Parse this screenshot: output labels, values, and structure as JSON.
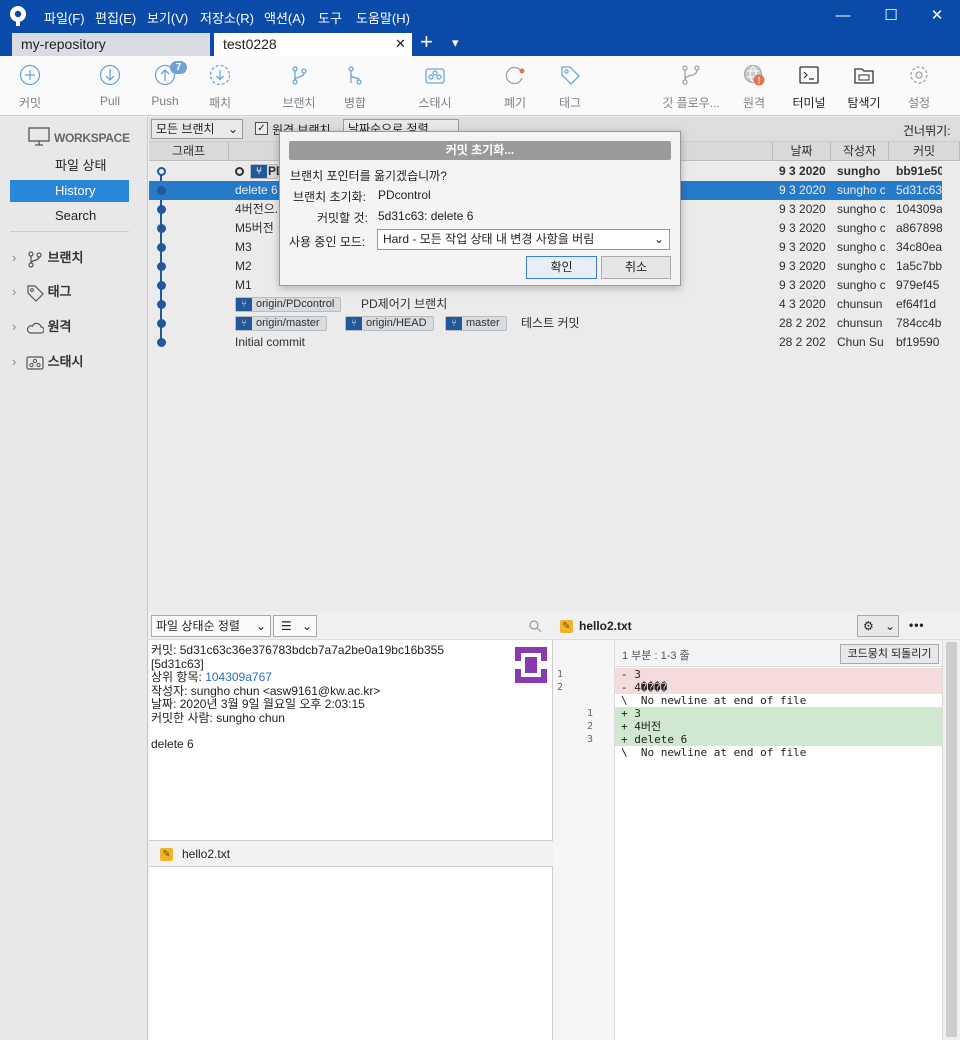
{
  "menubar": {
    "items": [
      "파일(F)",
      "편집(E)",
      "보기(V)",
      "저장소(R)",
      "액션(A)",
      "도구",
      "도움말(H)"
    ]
  },
  "window_controls": {
    "minimize": "—",
    "maximize": "☐",
    "close": "✕"
  },
  "tabs": [
    {
      "label": "my-repository",
      "active": false
    },
    {
      "label": "test0228",
      "active": true
    }
  ],
  "tabbar": {
    "close_glyph": "✕",
    "add_glyph": "+",
    "dropdown_glyph": "▾"
  },
  "toolbar": {
    "buttons": [
      {
        "label": "커밋",
        "icon": "plus-circle-icon"
      },
      {
        "label": "Pull",
        "icon": "arrow-down-circle-icon"
      },
      {
        "label": "Push",
        "icon": "arrow-up-circle-icon",
        "badge": "7"
      },
      {
        "label": "패치",
        "icon": "patch-icon"
      },
      {
        "label": "브랜치",
        "icon": "branch-icon"
      },
      {
        "label": "병합",
        "icon": "merge-icon"
      },
      {
        "label": "스태시",
        "icon": "stash-icon"
      },
      {
        "label": "폐기",
        "icon": "discard-icon"
      },
      {
        "label": "태그",
        "icon": "tag-icon"
      },
      {
        "label": "깃 플로우...",
        "icon": "git-flow-icon"
      },
      {
        "label": "원격",
        "icon": "globe-icon"
      },
      {
        "label": "터미널",
        "icon": "terminal-icon"
      },
      {
        "label": "탐색기",
        "icon": "folder-icon"
      },
      {
        "label": "설정",
        "icon": "gear-icon"
      }
    ]
  },
  "sidebar": {
    "workspace_label": "WORKSPACE",
    "items": [
      "파일 상태",
      "History",
      "Search"
    ],
    "selected": "History",
    "groups": [
      "브랜치",
      "태그",
      "원격",
      "스태시"
    ]
  },
  "history": {
    "filter": {
      "branch_select": "모든 브랜치",
      "checkbox_label": "원격 브랜치",
      "sort_select": "날짜순으로 정렬",
      "skip_label": "건너뛰기:"
    },
    "columns": {
      "graph": "그래프",
      "date": "날짜",
      "author": "작성자",
      "commit": "커밋"
    },
    "rows": [
      {
        "message": "PD",
        "date": "9 3 2020",
        "author": "sungho",
        "commit": "bb91e50",
        "bold": true,
        "badges": []
      },
      {
        "message": "delete 6",
        "date": "9 3 2020",
        "author": "sungho c",
        "commit": "5d31c63",
        "selected": true,
        "badges": []
      },
      {
        "message": "4버전으...",
        "date": "9 3 2020",
        "author": "sungho c",
        "commit": "104309a",
        "badges": []
      },
      {
        "message": "M5버전",
        "date": "9 3 2020",
        "author": "sungho c",
        "commit": "a867898",
        "badges": []
      },
      {
        "message": "M3",
        "date": "9 3 2020",
        "author": "sungho c",
        "commit": "34c80ea",
        "badges": []
      },
      {
        "message": "M2",
        "date": "9 3 2020",
        "author": "sungho c",
        "commit": "1a5c7bb",
        "badges": []
      },
      {
        "message": "M1",
        "date": "9 3 2020",
        "author": "sungho c",
        "commit": "979ef45",
        "badges": []
      },
      {
        "message": "PD제어기 브랜치",
        "date": "4 3 2020",
        "author": "chunsun",
        "commit": "ef64f1d",
        "badges": [
          "origin/PDcontrol"
        ]
      },
      {
        "message": "테스트 커밋",
        "date": "28 2 202",
        "author": "chunsun",
        "commit": "784cc4b",
        "badges": [
          "origin/master",
          "origin/HEAD",
          "master"
        ]
      },
      {
        "message": "Initial commit",
        "date": "28 2 202",
        "author": "Chun Su",
        "commit": "bf19590",
        "badges": []
      }
    ]
  },
  "dialog": {
    "title": "커밋 초기화...",
    "question": "브랜치 포인터를 옮기겠습니까?",
    "branch_label": "브랜치 초기화:",
    "branch_value": "PDcontrol",
    "target_label": "커밋할 것:",
    "target_value": "5d31c63: delete 6",
    "mode_label": "사용 중인 모드:",
    "mode_value": "Hard - 모든 작업 상태 내 변경 사항을 버림",
    "ok": "확인",
    "cancel": "취소"
  },
  "details": {
    "sort_select": "파일 상태순 정렬",
    "commit_line": "커밋: 5d31c63c36e376783bdcb7a7a2be0a19bc16b355",
    "short_hash": "[5d31c63]",
    "parent_label": "상위 항목:",
    "parent_value": "104309a767",
    "author_line": "작성자: sungho chun <asw9161@kw.ac.kr>",
    "date_line": "날짜: 2020년 3월 9일 월요일 오후 2:03:15",
    "committer_line": "커밋한 사람: sungho chun",
    "message": "delete 6",
    "file": "hello2.txt"
  },
  "diff": {
    "file": "hello2.txt",
    "hunk": "1 부분 : 1-3 줄",
    "revert_button": "코드뭉치 되돌리기",
    "more_glyph": "•••",
    "lines": [
      {
        "old": "1",
        "new": "",
        "text": "- 3",
        "type": "del"
      },
      {
        "old": "2",
        "new": "",
        "text": "- 4����",
        "type": "del"
      },
      {
        "old": "",
        "new": "",
        "text": "\\  No newline at end of file",
        "type": "ctx"
      },
      {
        "old": "",
        "new": "1",
        "text": "+ 3",
        "type": "add"
      },
      {
        "old": "",
        "new": "2",
        "text": "+ 4버전",
        "type": "add"
      },
      {
        "old": "",
        "new": "3",
        "text": "+ delete 6",
        "type": "add"
      },
      {
        "old": "",
        "new": "",
        "text": "\\  No newline at end of file",
        "type": "ctx"
      }
    ]
  },
  "colors": {
    "titlebar": "#0a4aa8",
    "selection": "#2a86d9",
    "graph": "#2560a8"
  }
}
